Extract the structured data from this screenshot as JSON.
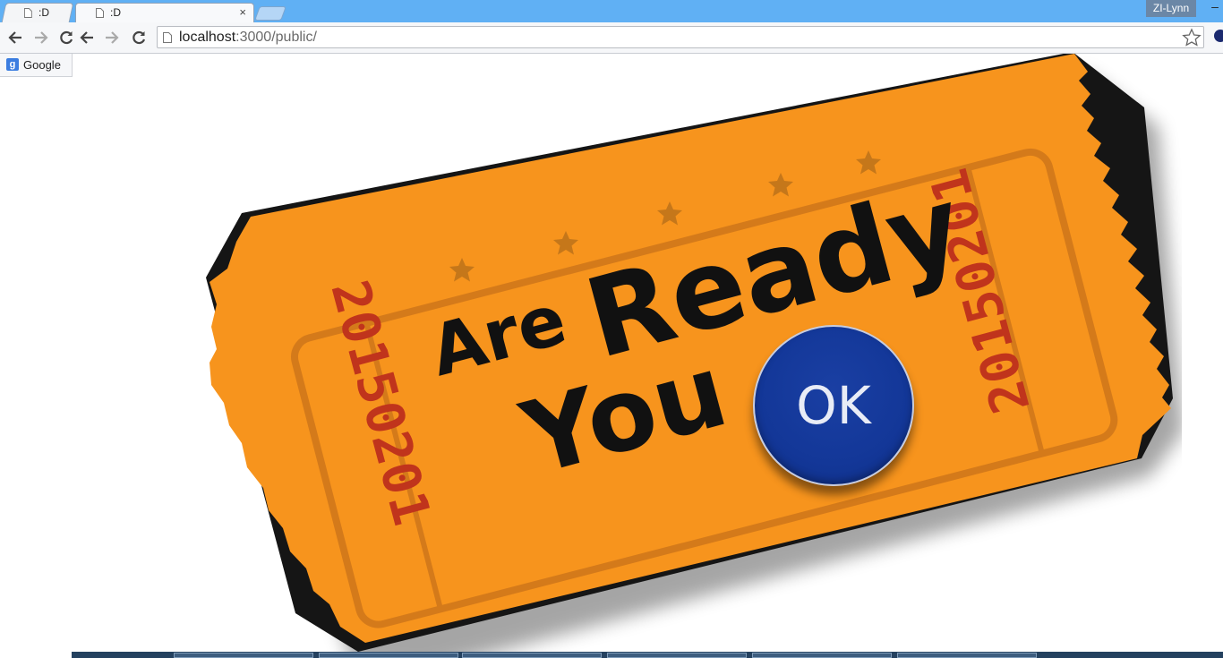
{
  "browser": {
    "tabs": [
      {
        "title": ":D"
      },
      {
        "title": ":D",
        "close_glyph": "×"
      }
    ],
    "profile_name": "ZI-Lynn",
    "minimize_glyph": "–",
    "url": {
      "host": "localhost",
      "rest": ":3000/public/"
    },
    "bookmarks": [
      {
        "label": "Google",
        "icon_letter": "g"
      }
    ]
  },
  "page": {
    "ticket": {
      "word_are": "Are",
      "word_ready": "Ready",
      "word_you": "You",
      "serial_left": "20150201",
      "serial_right": "20150201",
      "color": "#f7941d",
      "border_color": "#d47a1a",
      "serial_color": "#c0341c",
      "star_color": "#c5771a"
    },
    "ok_button": {
      "label": "OK",
      "color": "#133798"
    }
  },
  "taskbar": {
    "item_count": 6
  }
}
